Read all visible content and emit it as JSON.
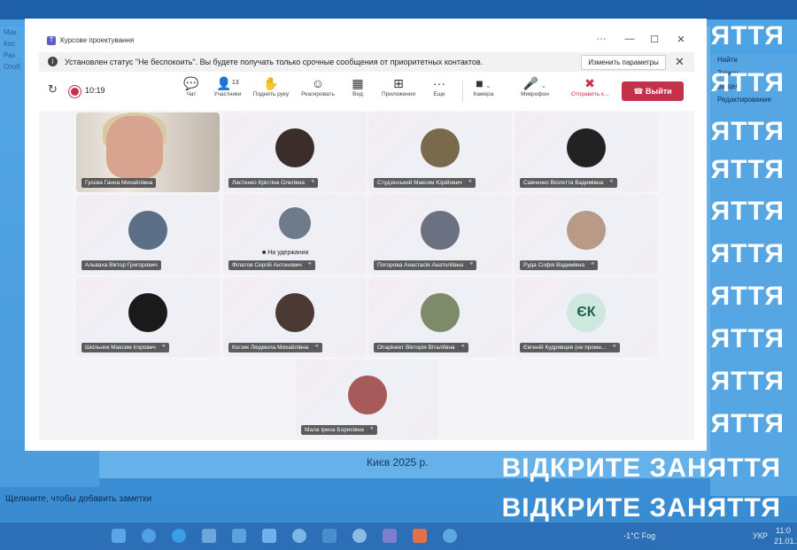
{
  "background": {
    "ppt_left_rows": [
      "Мак",
      "Кос",
      "Раз",
      "Отоб"
    ],
    "ppt_right_rows": [
      "Найти",
      "Замен",
      "Выдел",
      "Редактирование"
    ],
    "slide_footer": "Києв 2025 р.",
    "notes_placeholder": "Щелкните, чтобы добавить заметки",
    "overlay_text_partial": "ЯТТЯ",
    "overlay_text_full": "ВІДКРИТЕ ЗАНЯТТЯ",
    "taskbar": {
      "weather": "-1°C Fog",
      "lang": "УКР",
      "time": "11:0",
      "date": "21.01.2"
    }
  },
  "window": {
    "title": "Курсове проектування",
    "controls": {
      "more": "···",
      "minimize": "—",
      "maximize": "☐",
      "close": "✕"
    },
    "banner": {
      "message": "Установлен статус \"Не беспокоить\". Вы будете получать только срочные сообщения от приоритетных контактов.",
      "button": "Изменить параметры",
      "close": "✕"
    },
    "toolbar": {
      "timer": "10:19",
      "participants_count": "13",
      "items": [
        {
          "label": "Чат",
          "icon": "💬"
        },
        {
          "label": "Участники",
          "icon": "👤"
        },
        {
          "label": "Поднять руку",
          "icon": "✋"
        },
        {
          "label": "Реагировать",
          "icon": "☺"
        },
        {
          "label": "Вид",
          "icon": "▦"
        },
        {
          "label": "Приложения",
          "icon": "⊞"
        },
        {
          "label": "Еще",
          "icon": "···"
        },
        {
          "label": "Камера",
          "icon": "■"
        },
        {
          "label": "Микрофон",
          "icon": "🎤"
        },
        {
          "label": "Отправить к...",
          "icon": "✖"
        }
      ],
      "leave": "Выйти"
    },
    "participants": [
      {
        "name": "Гусєва Ганна Михайлівна",
        "type": "video"
      },
      {
        "name": "Ластенко Крістіна Олегівна",
        "type": "avatar",
        "color": "#3b2e2a"
      },
      {
        "name": "Студзінський Максим Юрійович",
        "type": "avatar",
        "color": "#7a6a4c"
      },
      {
        "name": "Савченко Віолетта Вадимівна",
        "type": "avatar",
        "color": "#222222"
      },
      {
        "name": "Альваха Віктор Григорович",
        "type": "avatar",
        "color": "#5b6f86"
      },
      {
        "name": "Філатов Сергій Антонович",
        "type": "avatar",
        "color": "#6d7b8a",
        "status": "На удержании"
      },
      {
        "name": "Погорова Анастасія Анатоліївна",
        "type": "avatar",
        "color": "#6b7180"
      },
      {
        "name": "Руда Софія Вадимівна",
        "type": "avatar",
        "color": "#b89a86"
      },
      {
        "name": "Шкільник Максим Ігорович",
        "type": "avatar",
        "color": "#1a1a1a"
      },
      {
        "name": "Когзик Людмила Михайлівна",
        "type": "avatar",
        "color": "#4b3a34"
      },
      {
        "name": "Опарінкет Вікторія Віталіївна",
        "type": "avatar",
        "color": "#7d8b6a"
      },
      {
        "name": "Євгеній Кудрявцев (не проме...",
        "type": "initials",
        "initials": "ЄК"
      },
      {
        "name": "Мала Ірина Борисівна",
        "type": "avatar",
        "color": "#a65a5a"
      }
    ]
  }
}
